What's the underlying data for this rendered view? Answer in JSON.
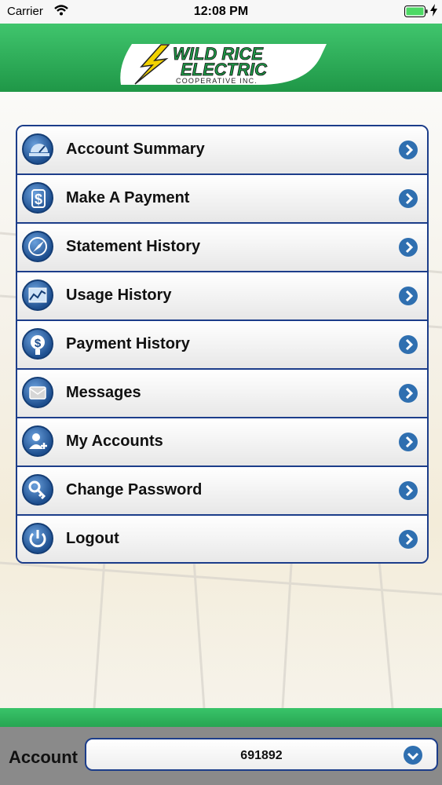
{
  "status_bar": {
    "carrier": "Carrier",
    "time": "12:08 PM"
  },
  "header": {
    "logo": {
      "line1": "WILD RICE",
      "line2": "ELECTRIC",
      "line3": "COOPERATIVE INC."
    }
  },
  "menu": {
    "items": [
      {
        "label": "Account Summary",
        "icon": "meter-icon"
      },
      {
        "label": "Make A Payment",
        "icon": "dollar-icon"
      },
      {
        "label": "Statement History",
        "icon": "compass-icon"
      },
      {
        "label": "Usage History",
        "icon": "chart-icon"
      },
      {
        "label": "Payment History",
        "icon": "coin-icon"
      },
      {
        "label": "Messages",
        "icon": "envelope-icon"
      },
      {
        "label": "My Accounts",
        "icon": "add-user-icon"
      },
      {
        "label": "Change Password",
        "icon": "key-icon"
      },
      {
        "label": "Logout",
        "icon": "power-icon"
      }
    ]
  },
  "footer": {
    "account_label": "Account",
    "account_value": "691892"
  },
  "colors": {
    "header_green": "#2fb15a",
    "menu_border": "#1c3d8a",
    "chevron_blue": "#2f6fb0",
    "footer_gray": "#8a8a8a"
  }
}
